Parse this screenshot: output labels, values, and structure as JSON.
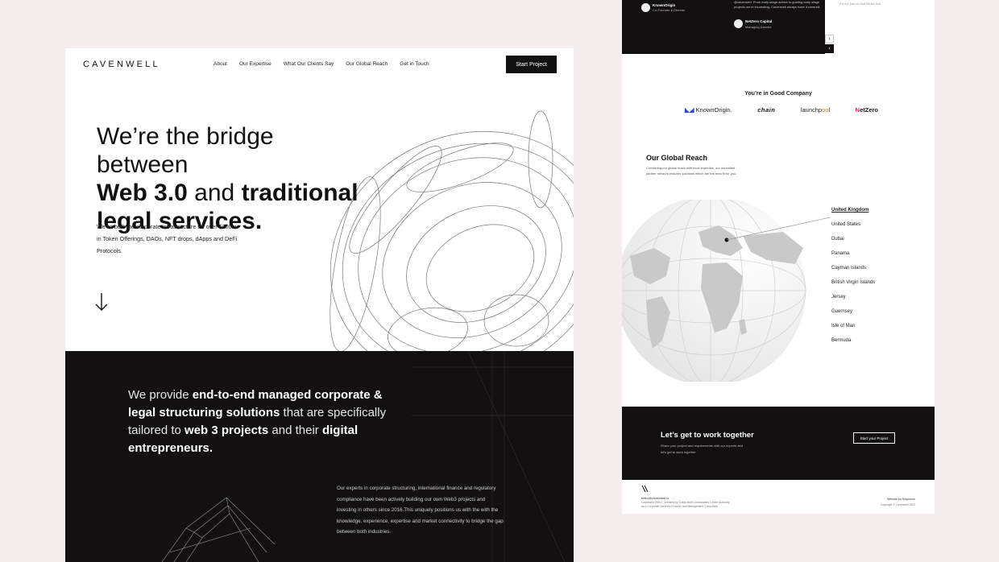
{
  "left": {
    "nav": {
      "logo": "CAVENWELL",
      "links": [
        "About",
        "Our Expertise",
        "What Our Clients Say",
        "Our Global Reach",
        "Get in Touch"
      ],
      "cta": "Start Project"
    },
    "hero": {
      "line1": "We’re the bridge between",
      "line2_bold": "Web 3.0",
      "line2_rest": " and ",
      "line2_bold2": "traditional",
      "line3_bold": "legal services.",
      "paragraph": "We’ve built the corporate infrastructure for over $200m in Token Offerings, DAOs, NFT drops, dApps and DeFi Protocols."
    },
    "about": {
      "t1": "We provide ",
      "b1": "end-to-end managed corporate & legal structuring solutions",
      "t2": " that are specifically tailored to ",
      "b2": "web 3 projects",
      "t3": " and their ",
      "b3": "digital entrepreneurs.",
      "paragraph": "Our experts in corporate structuring, international finance and regulatory compliance have been actively building our own Web3 projects and investing in others since 2016.This uniquely positions us with the with the knowledge, experience, expertise and market connectivity to bridge the gap between both industries."
    }
  },
  "right": {
    "testimonials": {
      "person1_name": "KnownOrigin",
      "person1_role": "Co-Founder & Director",
      "quote": "@cavenwell. From early-stage advice to guiding early stage projects we're incubating, Cavenwell always have it covered.",
      "person2_name": "NetZero Capital",
      "person2_role": "Managing Director",
      "side_text": "It's not just us that thinks that",
      "next": "›",
      "prev": "‹"
    },
    "company": {
      "title": "You’re in Good Company",
      "logos": {
        "ko_mark": "◣◢",
        "ko_text": "KnownOrigin.",
        "chain": "chain",
        "launch_a": "launchp",
        "launch_b": "oo",
        "launch_c": "l",
        "nz_mark": "N",
        "nz_text": "etZero"
      }
    },
    "reach": {
      "title": "Our Global Reach",
      "paragraph": "Combining our global reach with local expertise, our unrivalled partner network ensures solutions which are the best fit for you.",
      "countries": [
        "United Kingdom",
        "United States",
        "Dubai",
        "Panama",
        "Cayman Islands",
        "British Virgin Islands",
        "Jersey",
        "Guernsey",
        "Isle of Man",
        "Bermuda"
      ],
      "active": "United Kingdom"
    },
    "cta": {
      "title": "Let’s get to work together",
      "paragraph": "Share your project and requirements with our experts and let’s get to work together",
      "button": "Start your Project"
    },
    "footer": {
      "email": "hello@cavenwell.io",
      "legal": "Cavenwell DMCC, licensed by Dubai Multi Commodities Centre Authority as a Corporate Services Provider and Management Consultant.",
      "by": "Website by Sequence",
      "copyright": "Copyright © Cavenwell 2022"
    }
  }
}
